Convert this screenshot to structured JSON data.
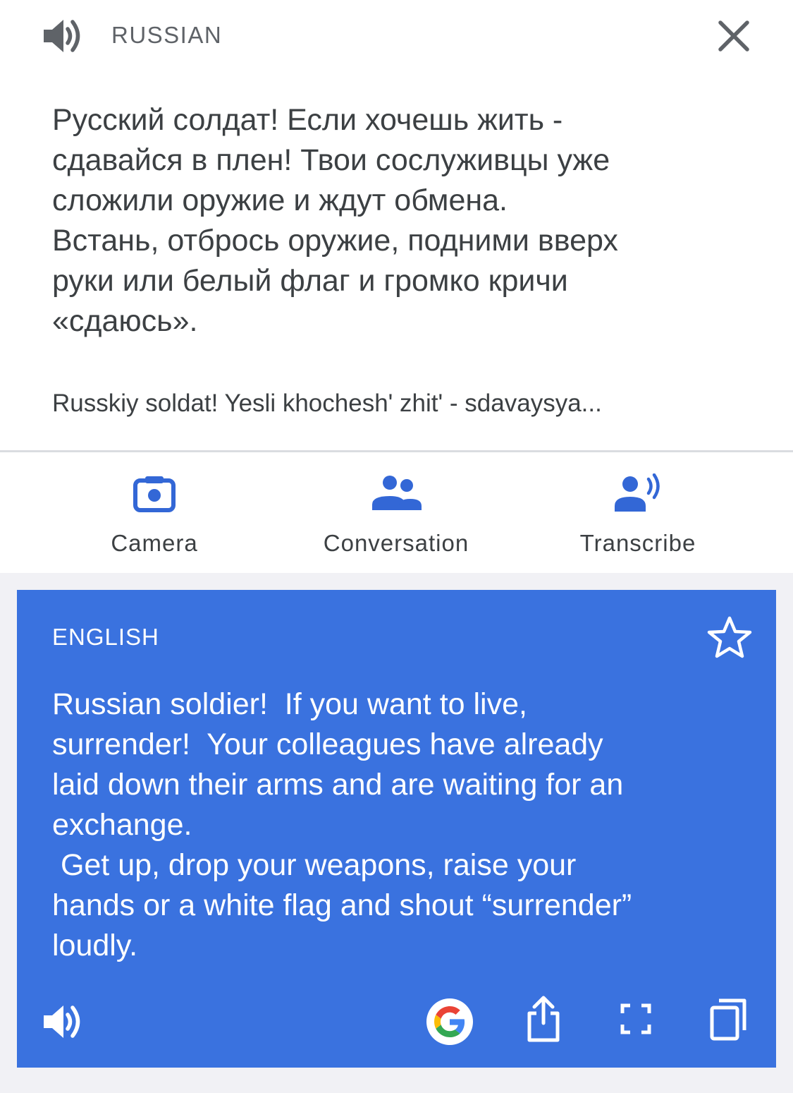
{
  "source": {
    "language": "RUSSIAN",
    "text_lines": [
      "Русский солдат! Если хочешь жить -",
      "сдавайся в плен! Твои сослуживцы уже",
      "сложили оружие и ждут обмена.",
      "Встань, отбрось оружие, подними вверх",
      "руки или белый флаг и громко кричи",
      "«сдаюсь»."
    ],
    "transliteration": "Russkiy soldat! Yesli khochesh' zhit' - sdavaysya..."
  },
  "modes": [
    {
      "label": "Camera",
      "icon": "camera-icon"
    },
    {
      "label": "Conversation",
      "icon": "people-icon"
    },
    {
      "label": "Transcribe",
      "icon": "transcribe-icon"
    }
  ],
  "target": {
    "language": "ENGLISH",
    "text_lines": [
      "Russian soldier!  If you want to live,",
      "surrender!  Your colleagues have already",
      "laid down their arms and are waiting for an",
      "exchange.",
      " Get up, drop your weapons, raise your",
      "hands or a white flag and shout “surrender”",
      "loudly."
    ]
  },
  "colors": {
    "accent": "#3a72df",
    "icon_blue": "#3367d6",
    "text": "#3c4043",
    "muted": "#5f6368",
    "divider": "#dadce0"
  }
}
